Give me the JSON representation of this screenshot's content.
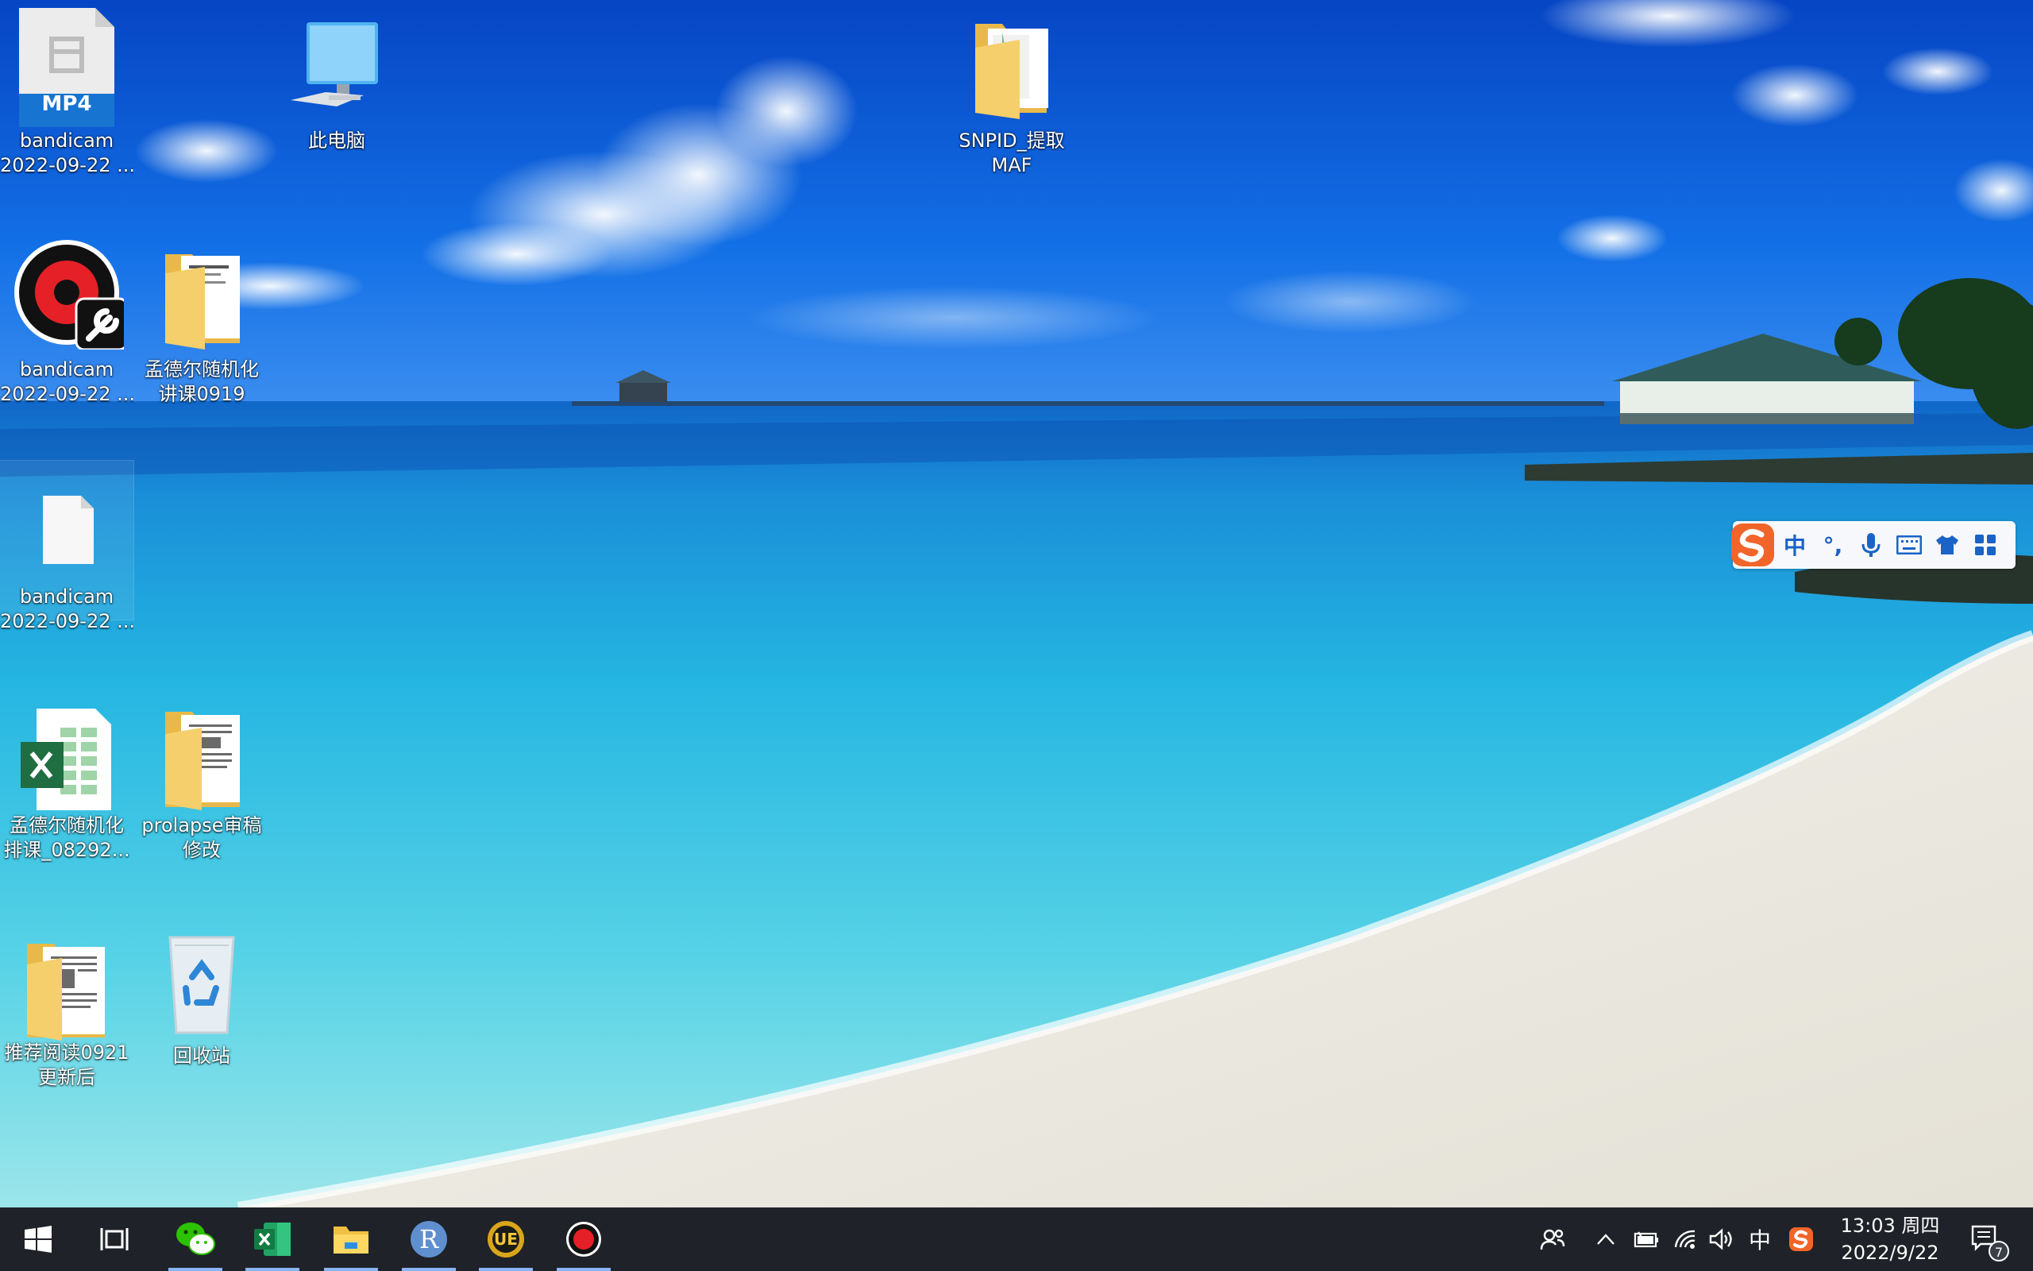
{
  "desktop_icons": [
    {
      "name": "bandicam-mp4",
      "icon": "mp4-file-icon",
      "badge": "MP4",
      "line1": "bandicam",
      "line2": "2022-09-22 ..."
    },
    {
      "name": "this-pc",
      "icon": "computer-icon",
      "line1": "此电脑",
      "line2": ""
    },
    {
      "name": "snpid",
      "icon": "folder-icon",
      "line1": "SNPID_提取",
      "line2": "MAF"
    },
    {
      "name": "bandicam-app",
      "icon": "bandicam-tool-icon",
      "line1": "bandicam",
      "line2": "2022-09-22 ..."
    },
    {
      "name": "mendel-folder",
      "icon": "folder-icon",
      "line1": "孟德尔随机化",
      "line2": "讲课0919"
    },
    {
      "name": "bandicam-file",
      "icon": "blank-file-icon",
      "line1": "bandicam",
      "line2": "2022-09-22 ..."
    },
    {
      "name": "mendel-excel",
      "icon": "excel-file-icon",
      "line1": "孟德尔随机化",
      "line2": "排课_08292..."
    },
    {
      "name": "prolapse-folder",
      "icon": "folder-icon",
      "line1": "prolapse审稿",
      "line2": "修改"
    },
    {
      "name": "reading-folder",
      "icon": "folder-icon",
      "line1": "推荐阅读0921",
      "line2": "更新后"
    },
    {
      "name": "recycle-bin",
      "icon": "recycle-bin-icon",
      "line1": "回收站",
      "line2": ""
    }
  ],
  "ime": {
    "mode": "中",
    "punct": "°,",
    "icons": [
      "sogou-logo-icon",
      "mic-icon",
      "keyboard-icon",
      "skin-shirt-icon",
      "apps-grid-icon"
    ]
  },
  "taskbar": {
    "apps": [
      {
        "name": "wechat",
        "icon": "wechat-icon"
      },
      {
        "name": "excel",
        "icon": "excel-icon"
      },
      {
        "name": "file-explorer",
        "icon": "folder-icon"
      },
      {
        "name": "r",
        "icon": "r-icon",
        "letter": "R"
      },
      {
        "name": "ultraedit",
        "icon": "ultraedit-icon",
        "letter": "UE"
      },
      {
        "name": "bandicam",
        "icon": "record-icon"
      }
    ],
    "tray": {
      "ime_label": "中",
      "notification_count": "7"
    },
    "clock": {
      "time": "13:03 周四",
      "date": "2022/9/22"
    }
  },
  "colors": {
    "taskbar": "#1f2228",
    "accent": "#8ab4f8",
    "sky": "#0a5bd8",
    "sea": "#2bb8df"
  }
}
